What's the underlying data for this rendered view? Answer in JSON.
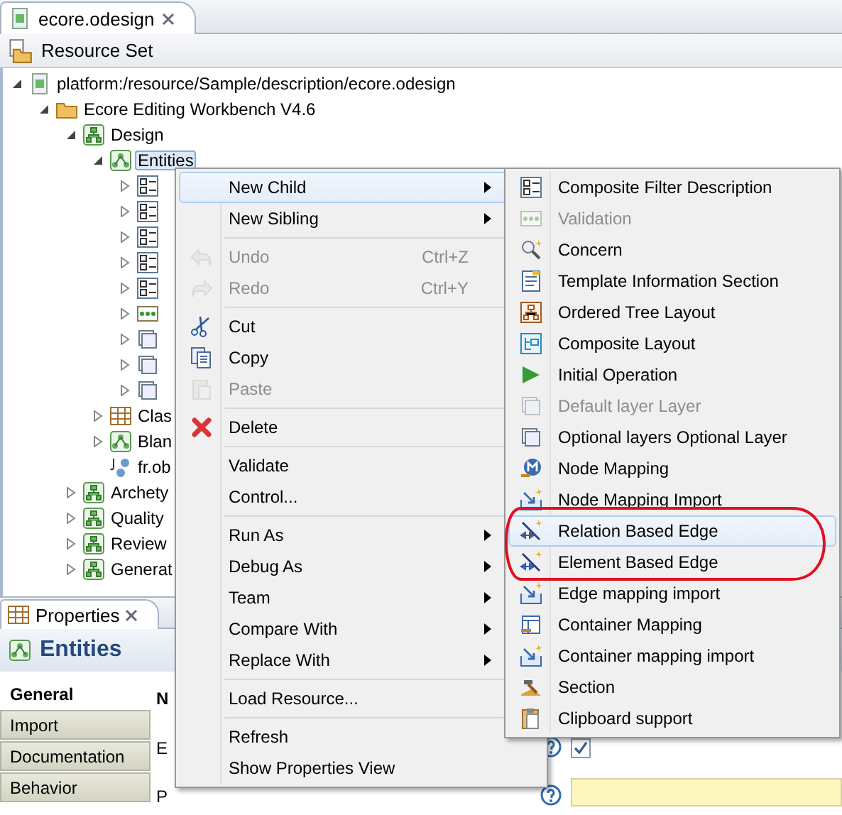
{
  "editor_tab": {
    "title": "ecore.odesign"
  },
  "header": {
    "title": "Resource Set"
  },
  "tree": [
    {
      "label": "platform:/resource/Sample/description/ecore.odesign",
      "kind": "resource",
      "expanded": true,
      "selected": false,
      "children": [
        {
          "label": "Ecore Editing Workbench V4.6",
          "kind": "folder",
          "expanded": true,
          "selected": false,
          "children": [
            {
              "label": "Design",
              "kind": "viewpoint",
              "expanded": true,
              "selected": false,
              "children": [
                {
                  "label": "Entities",
                  "kind": "diagram",
                  "expanded": true,
                  "selected": true,
                  "children": [
                    {
                      "kind": "filter",
                      "expanded": false,
                      "selected": false
                    },
                    {
                      "kind": "filter",
                      "expanded": false,
                      "selected": false
                    },
                    {
                      "kind": "filter",
                      "expanded": false,
                      "selected": false
                    },
                    {
                      "kind": "filter",
                      "expanded": false,
                      "selected": false
                    },
                    {
                      "kind": "filter",
                      "expanded": false,
                      "selected": false
                    },
                    {
                      "kind": "validation",
                      "expanded": false,
                      "selected": false
                    },
                    {
                      "kind": "layer",
                      "expanded": false,
                      "selected": false
                    },
                    {
                      "kind": "layer",
                      "expanded": false,
                      "selected": false
                    },
                    {
                      "kind": "layer",
                      "expanded": false,
                      "selected": false
                    }
                  ]
                },
                {
                  "label": "Clas",
                  "kind": "table",
                  "expanded": false,
                  "selected": false
                },
                {
                  "label": "Blan",
                  "kind": "diagram",
                  "expanded": false,
                  "selected": false
                },
                {
                  "label": "fr.ob",
                  "kind": "java",
                  "selected": false
                }
              ]
            },
            {
              "label": "Archety",
              "kind": "viewpoint",
              "expanded": false,
              "selected": false
            },
            {
              "label": "Quality",
              "kind": "viewpoint",
              "expanded": false,
              "selected": false
            },
            {
              "label": "Review",
              "kind": "viewpoint",
              "expanded": false,
              "selected": false
            },
            {
              "label": "Generat",
              "kind": "viewpoint",
              "expanded": false,
              "selected": false
            }
          ]
        }
      ]
    }
  ],
  "properties": {
    "tab": "Properties",
    "title": "Entities",
    "sections": [
      {
        "label": "General",
        "selected": true
      },
      {
        "label": "Import",
        "selected": false
      },
      {
        "label": "Documentation",
        "selected": false
      },
      {
        "label": "Behavior",
        "selected": false
      }
    ],
    "fields": [
      {
        "label": "N",
        "kind": "label"
      },
      {
        "label": "E",
        "kind": "checkbox",
        "checked": true
      },
      {
        "label": "P",
        "kind": "text"
      }
    ]
  },
  "context_menu": [
    {
      "kind": "plain",
      "label": "New Child",
      "submenu": true,
      "selected": true,
      "disabled": false
    },
    {
      "kind": "plain",
      "label": "New Sibling",
      "submenu": true,
      "selected": false,
      "disabled": false
    },
    {
      "kind": "separator"
    },
    {
      "kind": "undo",
      "label": "Undo",
      "shortcut": "Ctrl+Z",
      "submenu": false,
      "selected": false,
      "disabled": true
    },
    {
      "kind": "redo",
      "label": "Redo",
      "shortcut": "Ctrl+Y",
      "submenu": false,
      "selected": false,
      "disabled": true
    },
    {
      "kind": "separator"
    },
    {
      "kind": "cut",
      "label": "Cut",
      "submenu": false,
      "selected": false,
      "disabled": false
    },
    {
      "kind": "copy",
      "label": "Copy",
      "submenu": false,
      "selected": false,
      "disabled": false
    },
    {
      "kind": "paste",
      "label": "Paste",
      "submenu": false,
      "selected": false,
      "disabled": true
    },
    {
      "kind": "separator"
    },
    {
      "kind": "delete",
      "label": "Delete",
      "submenu": false,
      "selected": false,
      "disabled": false
    },
    {
      "kind": "separator"
    },
    {
      "kind": "plain",
      "label": "Validate",
      "submenu": false,
      "selected": false,
      "disabled": false
    },
    {
      "kind": "plain",
      "label": "Control...",
      "submenu": false,
      "selected": false,
      "disabled": false
    },
    {
      "kind": "separator"
    },
    {
      "kind": "plain",
      "label": "Run As",
      "submenu": true,
      "selected": false,
      "disabled": false
    },
    {
      "kind": "plain",
      "label": "Debug As",
      "submenu": true,
      "selected": false,
      "disabled": false
    },
    {
      "kind": "plain",
      "label": "Team",
      "submenu": true,
      "selected": false,
      "disabled": false
    },
    {
      "kind": "plain",
      "label": "Compare With",
      "submenu": true,
      "selected": false,
      "disabled": false
    },
    {
      "kind": "plain",
      "label": "Replace With",
      "submenu": true,
      "selected": false,
      "disabled": false
    },
    {
      "kind": "separator"
    },
    {
      "kind": "plain",
      "label": "Load Resource...",
      "submenu": false,
      "selected": false,
      "disabled": false
    },
    {
      "kind": "separator"
    },
    {
      "kind": "plain",
      "label": "Refresh",
      "submenu": false,
      "selected": false,
      "disabled": false
    },
    {
      "kind": "plain",
      "label": "Show Properties View",
      "submenu": false,
      "selected": false,
      "disabled": false
    }
  ],
  "submenu": [
    {
      "kind": "filter",
      "label": "Composite Filter Description",
      "selected": false,
      "disabled": false
    },
    {
      "kind": "validation",
      "label": "Validation",
      "selected": false,
      "disabled": true
    },
    {
      "kind": "concern",
      "label": "Concern",
      "selected": false,
      "disabled": false
    },
    {
      "kind": "template",
      "label": "Template Information Section",
      "selected": false,
      "disabled": false
    },
    {
      "kind": "tree-layout",
      "label": "Ordered Tree Layout",
      "selected": false,
      "disabled": false
    },
    {
      "kind": "composite-layout",
      "label": "Composite Layout",
      "selected": false,
      "disabled": false
    },
    {
      "kind": "operation",
      "label": "Initial Operation",
      "selected": false,
      "disabled": false
    },
    {
      "kind": "layer",
      "label": "Default layer Layer",
      "selected": false,
      "disabled": true
    },
    {
      "kind": "layer",
      "label": "Optional layers Optional Layer",
      "selected": false,
      "disabled": false
    },
    {
      "kind": "node",
      "label": "Node Mapping",
      "selected": false,
      "disabled": false
    },
    {
      "kind": "import",
      "label": "Node Mapping Import",
      "selected": false,
      "disabled": false
    },
    {
      "kind": "edge",
      "label": "Relation Based Edge",
      "selected": true,
      "disabled": false
    },
    {
      "kind": "edge",
      "label": "Element Based Edge",
      "selected": false,
      "disabled": false
    },
    {
      "kind": "import",
      "label": "Edge mapping import",
      "selected": false,
      "disabled": false
    },
    {
      "kind": "container",
      "label": "Container Mapping",
      "selected": false,
      "disabled": false
    },
    {
      "kind": "import",
      "label": "Container mapping import",
      "selected": false,
      "disabled": false
    },
    {
      "kind": "section",
      "label": "Section",
      "selected": false,
      "disabled": false
    },
    {
      "kind": "clipboard",
      "label": "Clipboard support",
      "selected": false,
      "disabled": false
    }
  ]
}
